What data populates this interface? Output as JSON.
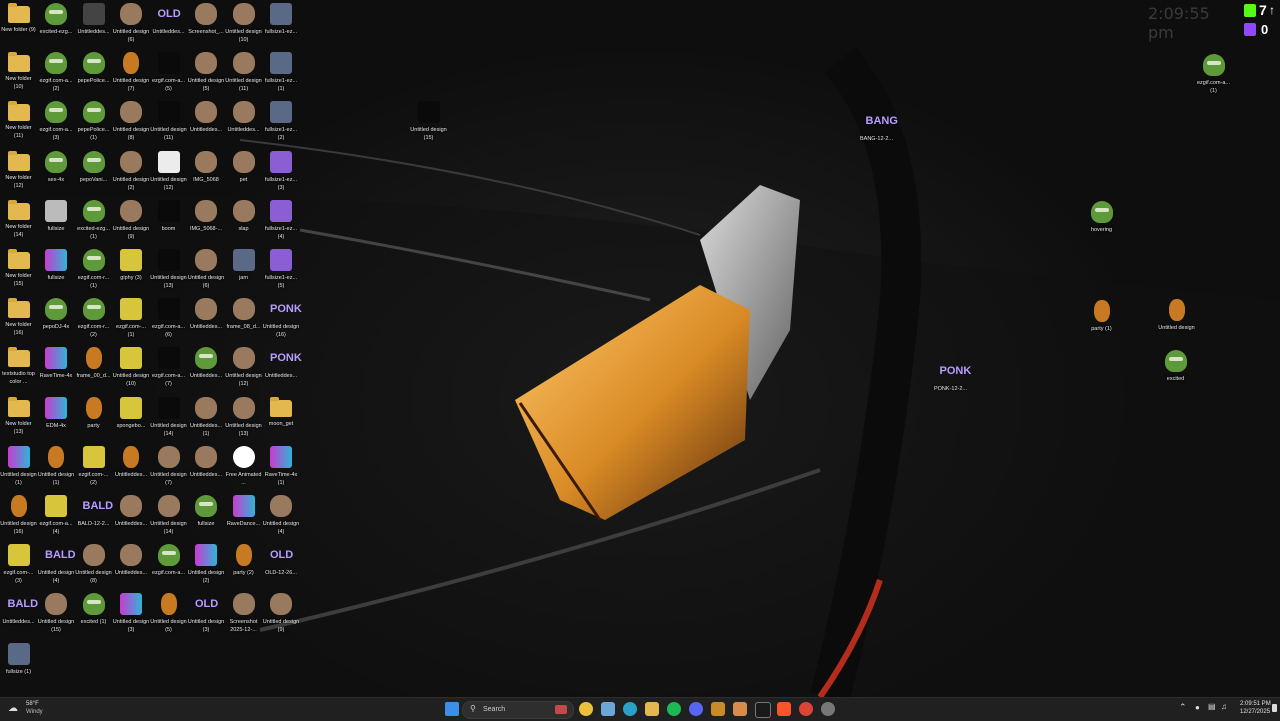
{
  "desktop": {
    "icons": [
      {
        "label": "New folder (9)",
        "kind": "folder"
      },
      {
        "label": "excited-ezg...",
        "kind": "pepe"
      },
      {
        "label": "Untitleddes...",
        "kind": "pixel"
      },
      {
        "label": "Untitled design (6)",
        "kind": "face"
      },
      {
        "label": "Untitleddes...",
        "kind": "wordart",
        "glyph": "OLD"
      },
      {
        "label": "Screenshot_...",
        "kind": "face"
      },
      {
        "label": "Untitled design (10)",
        "kind": "face"
      },
      {
        "label": "fullsize1-ez...",
        "kind": "man"
      },
      {
        "label": "New folder (10)",
        "kind": "folder"
      },
      {
        "label": "ezgif.com-a... (2)",
        "kind": "pepe"
      },
      {
        "label": "pepePolice...",
        "kind": "pepe"
      },
      {
        "label": "Untitled design (7)",
        "kind": "orangeface"
      },
      {
        "label": "ezgif.com-a... (5)",
        "kind": "dark"
      },
      {
        "label": "Untitled design (5)",
        "kind": "face"
      },
      {
        "label": "Untitled design (11)",
        "kind": "face"
      },
      {
        "label": "fullsize1-ez... (1)",
        "kind": "man"
      },
      {
        "label": "New folder (11)",
        "kind": "folder"
      },
      {
        "label": "ezgif.com-a... (3)",
        "kind": "pepe"
      },
      {
        "label": "pepePolice... (1)",
        "kind": "pepe"
      },
      {
        "label": "Untitled design (8)",
        "kind": "face"
      },
      {
        "label": "Untitled design (11)",
        "kind": "dark"
      },
      {
        "label": "Untitleddes...",
        "kind": "face"
      },
      {
        "label": "Untitleddes...",
        "kind": "face"
      },
      {
        "label": "fullsize1-ez... (2)",
        "kind": "man"
      },
      {
        "label": "New folder (12)",
        "kind": "folder"
      },
      {
        "label": "sex-4x",
        "kind": "pepe"
      },
      {
        "label": "pepoVani...",
        "kind": "pepe"
      },
      {
        "label": "Untitled design (2)",
        "kind": "face"
      },
      {
        "label": "Untitled design (12)",
        "kind": "white"
      },
      {
        "label": "IMG_5068",
        "kind": "face"
      },
      {
        "label": "pet",
        "kind": "face"
      },
      {
        "label": "fullsize1-ez... (3)",
        "kind": "purple"
      },
      {
        "label": "New folder (14)",
        "kind": "folder"
      },
      {
        "label": "fullsize",
        "kind": "text"
      },
      {
        "label": "excited-ezg... (1)",
        "kind": "pepe"
      },
      {
        "label": "Untitled design (9)",
        "kind": "face"
      },
      {
        "label": "boom",
        "kind": "dark"
      },
      {
        "label": "IMG_5068-...",
        "kind": "face"
      },
      {
        "label": "slap",
        "kind": "face"
      },
      {
        "label": "fullsize1-ez... (4)",
        "kind": "purple"
      },
      {
        "label": "New folder (15)",
        "kind": "folder"
      },
      {
        "label": "fullsize",
        "kind": "rave"
      },
      {
        "label": "ezgif.com-r... (1)",
        "kind": "pepe"
      },
      {
        "label": "giphy (3)",
        "kind": "sponge"
      },
      {
        "label": "Untitled design (13)",
        "kind": "dark"
      },
      {
        "label": "Untitled design (6)",
        "kind": "face"
      },
      {
        "label": "jam",
        "kind": "man"
      },
      {
        "label": "fullsize1-ez... (5)",
        "kind": "purple"
      },
      {
        "label": "New folder (16)",
        "kind": "folder"
      },
      {
        "label": "pepoDJ-4x",
        "kind": "pepe"
      },
      {
        "label": "ezgif.com-r... (2)",
        "kind": "pepe"
      },
      {
        "label": "ezgif.com-... (1)",
        "kind": "sponge"
      },
      {
        "label": "ezgif.com-a... (6)",
        "kind": "dark"
      },
      {
        "label": "Untitleddes...",
        "kind": "face"
      },
      {
        "label": "frame_08_d...",
        "kind": "face"
      },
      {
        "label": "Untitled design (16)",
        "kind": "wordart",
        "glyph": "PONK"
      },
      {
        "label": "textstudio top color ...",
        "kind": "folder"
      },
      {
        "label": "RaveTime-4x",
        "kind": "rave"
      },
      {
        "label": "frame_00_d...",
        "kind": "orangeface"
      },
      {
        "label": "Untitled design (10)",
        "kind": "sponge"
      },
      {
        "label": "ezgif.com-a... (7)",
        "kind": "dark"
      },
      {
        "label": "Untitleddes...",
        "kind": "pepe"
      },
      {
        "label": "Untitled design (12)",
        "kind": "face"
      },
      {
        "label": "Untitleddes...",
        "kind": "wordart",
        "glyph": "PONK"
      },
      {
        "label": "New folder (13)",
        "kind": "folder"
      },
      {
        "label": "EDM-4x",
        "kind": "rave"
      },
      {
        "label": "party",
        "kind": "orangeface"
      },
      {
        "label": "spongebo...",
        "kind": "sponge"
      },
      {
        "label": "Untitled design (14)",
        "kind": "dark"
      },
      {
        "label": "Untitleddes... (1)",
        "kind": "face"
      },
      {
        "label": "Untitled design (13)",
        "kind": "face"
      },
      {
        "label": "moon_get",
        "kind": "folder"
      },
      {
        "label": "Untitled design (1)",
        "kind": "rave"
      },
      {
        "label": "Untitled design (1)",
        "kind": "orangeface"
      },
      {
        "label": "ezgif.com-... (2)",
        "kind": "sponge"
      },
      {
        "label": "Untitleddes...",
        "kind": "orangeface"
      },
      {
        "label": "Untitled design (7)",
        "kind": "face"
      },
      {
        "label": "Untitleddes...",
        "kind": "face"
      },
      {
        "label": "Free Animated ...",
        "kind": "chrome"
      },
      {
        "label": "RaveTime-4x (1)",
        "kind": "rave"
      },
      {
        "label": "Untitled design (16)",
        "kind": "orangeface"
      },
      {
        "label": "ezgif.com-a... (4)",
        "kind": "sponge"
      },
      {
        "label": "BALD-12-2...",
        "kind": "wordart",
        "glyph": "BALD"
      },
      {
        "label": "Untitleddes...",
        "kind": "face"
      },
      {
        "label": "Untitled design (14)",
        "kind": "face"
      },
      {
        "label": "fullsize",
        "kind": "pepe"
      },
      {
        "label": "RaveDance...",
        "kind": "rave"
      },
      {
        "label": "Untitled design (4)",
        "kind": "face"
      },
      {
        "label": "ezgif.com-... (3)",
        "kind": "sponge"
      },
      {
        "label": "Untitled design (4)",
        "kind": "wordart",
        "glyph": "BALD"
      },
      {
        "label": "Untitled design (8)",
        "kind": "face"
      },
      {
        "label": "Untitleddes...",
        "kind": "face"
      },
      {
        "label": "ezgif.com-a...",
        "kind": "pepe"
      },
      {
        "label": "Untitled design (2)",
        "kind": "rave"
      },
      {
        "label": "party (2)",
        "kind": "orangeface"
      },
      {
        "label": "OLD-12-26...",
        "kind": "wordart",
        "glyph": "OLD"
      },
      {
        "label": "Untitleddes...",
        "kind": "wordart",
        "glyph": "BALD"
      },
      {
        "label": "Untitled design (15)",
        "kind": "face"
      },
      {
        "label": "excited (1)",
        "kind": "pepe"
      },
      {
        "label": "Untitled design (3)",
        "kind": "rave"
      },
      {
        "label": "Untitled design (5)",
        "kind": "orangeface"
      },
      {
        "label": "Untitled design (3)",
        "kind": "wordart",
        "glyph": "OLD"
      },
      {
        "label": "Screenshot 2025-12-...",
        "kind": "face"
      },
      {
        "label": "Untitled design (9)",
        "kind": "face"
      },
      {
        "label": "fullsize (1)",
        "kind": "man"
      }
    ],
    "floating_icons": [
      {
        "label": "Untitled design (15)",
        "kind": "dark",
        "name": "desktop-icon-untitled-design-15"
      },
      {
        "label": "BANG-12-2...",
        "kind": "wordart",
        "glyph": "BANG",
        "name": "desktop-icon-bang"
      },
      {
        "label": "ezgif.com-a... (1)",
        "kind": "pepe",
        "name": "desktop-icon-ezgif-right"
      },
      {
        "label": "hovering",
        "kind": "pepe",
        "name": "desktop-icon-hovering"
      },
      {
        "label": "party (1)",
        "kind": "orangeface",
        "name": "desktop-icon-party-1"
      },
      {
        "label": "Untitled design",
        "kind": "orangeface",
        "name": "desktop-icon-untitled-design"
      },
      {
        "label": "PONK-12-2...",
        "kind": "wordart",
        "glyph": "PONK",
        "name": "desktop-icon-ponk"
      },
      {
        "label": "excited",
        "kind": "pepe",
        "name": "desktop-icon-excited"
      }
    ],
    "clock_overlay": "2:09:55 pm",
    "kick_count": "7",
    "twitch_count": "0"
  },
  "taskbar": {
    "weather_temp": "58°F",
    "weather_desc": "Windy",
    "search_placeholder": "Search",
    "time": "2:09:51 PM",
    "date": "12/27/2025"
  },
  "colors": {
    "accent": "#3b8eea",
    "kick": "#53fc18",
    "twitch": "#9146ff"
  }
}
